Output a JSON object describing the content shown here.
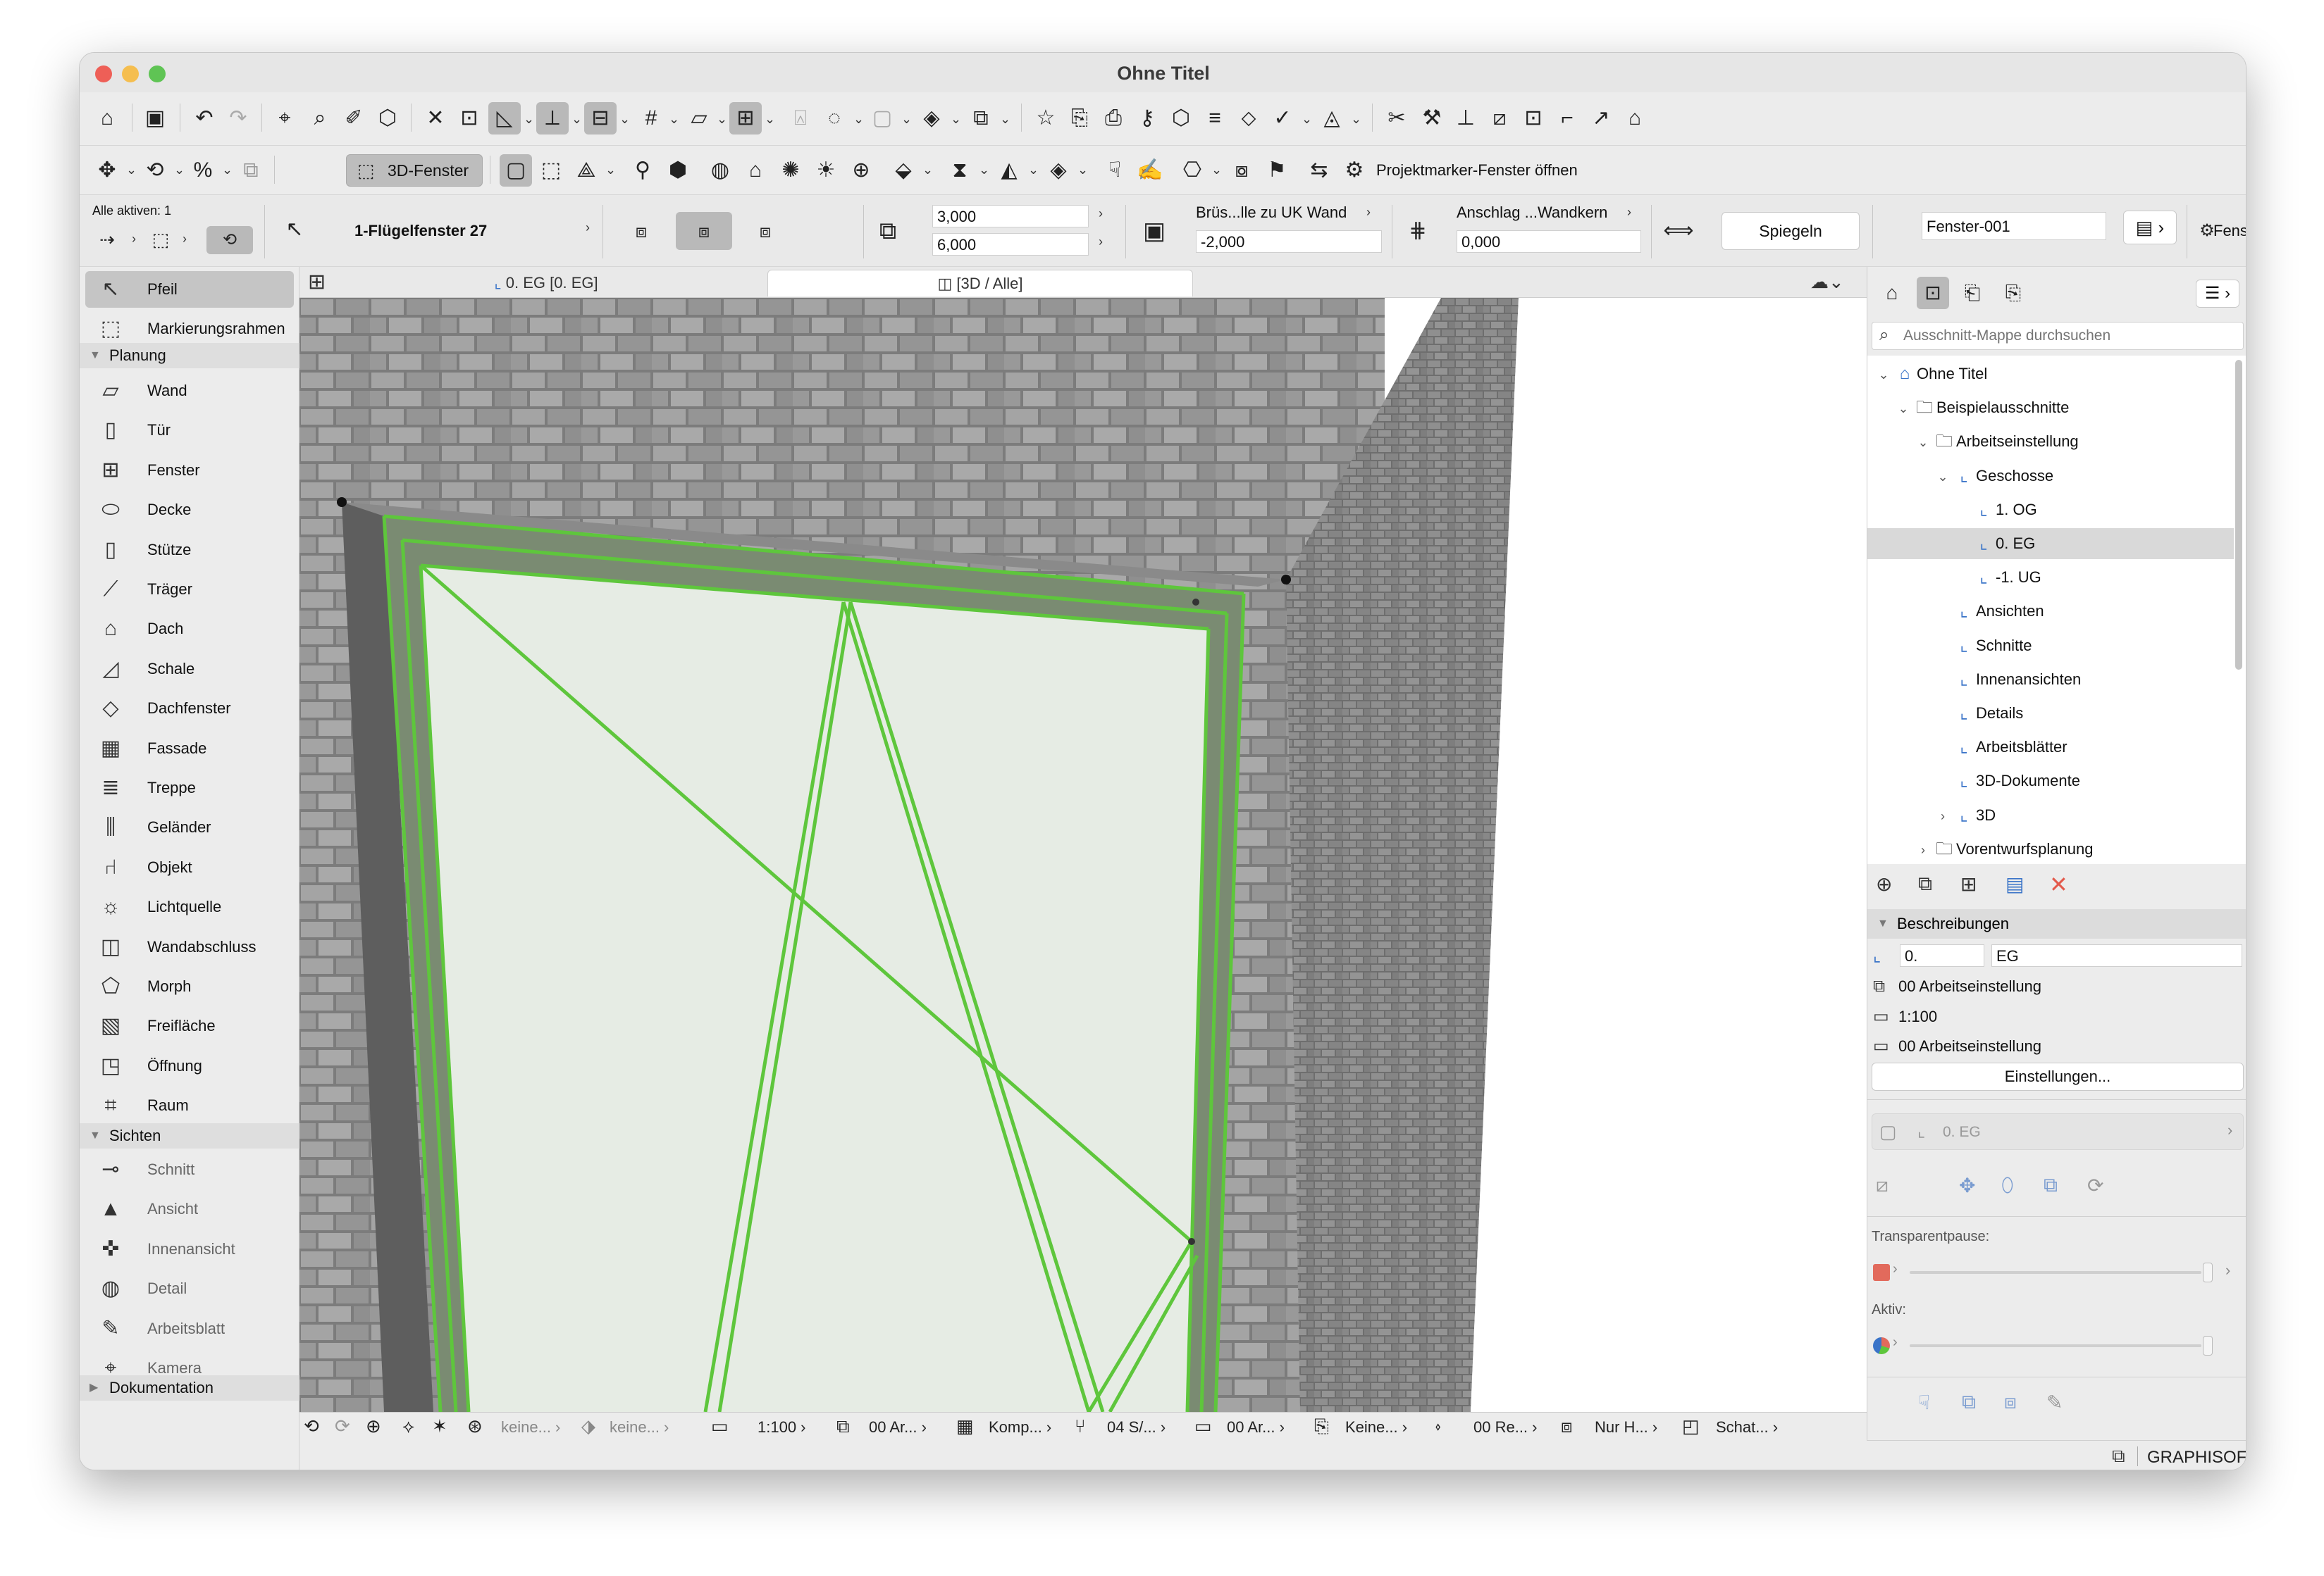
{
  "window": {
    "title": "Ohne Titel"
  },
  "toolbar2": {
    "view_3d_button": "3D-Fenster",
    "marker_button": "Projektmarker-Fenster öffnen"
  },
  "infobox": {
    "all_active": "Alle aktiven: 1",
    "element_name": "1-Flügelfenster 27",
    "width": "3,000",
    "height": "6,000",
    "sill_label": "Brüs...lle zu UK Wand",
    "sill_value": "-2,000",
    "anchor_label": "Anschlag ...Wandkern",
    "anchor_value": "0,000",
    "mirror_button": "Spiegeln",
    "element_id": "Fenster-001",
    "window_label": "Fens"
  },
  "toolbox": {
    "top_tools": [
      {
        "label": "Pfeil",
        "icon": "arrow-pointer-icon",
        "glyph": "↖"
      },
      {
        "label": "Markierungsrahmen",
        "icon": "marquee-icon",
        "glyph": "⬚"
      }
    ],
    "group_planung": "Planung",
    "planung_tools": [
      {
        "label": "Wand",
        "icon": "wall-icon",
        "glyph": "▱"
      },
      {
        "label": "Tür",
        "icon": "door-icon",
        "glyph": "▯"
      },
      {
        "label": "Fenster",
        "icon": "window-icon",
        "glyph": "⊞"
      },
      {
        "label": "Decke",
        "icon": "slab-icon",
        "glyph": "⬭"
      },
      {
        "label": "Stütze",
        "icon": "column-icon",
        "glyph": "▯"
      },
      {
        "label": "Träger",
        "icon": "beam-icon",
        "glyph": "⟋"
      },
      {
        "label": "Dach",
        "icon": "roof-icon",
        "glyph": "⌂"
      },
      {
        "label": "Schale",
        "icon": "shell-icon",
        "glyph": "◿"
      },
      {
        "label": "Dachfenster",
        "icon": "skylight-icon",
        "glyph": "◇"
      },
      {
        "label": "Fassade",
        "icon": "curtain-wall-icon",
        "glyph": "▦"
      },
      {
        "label": "Treppe",
        "icon": "stair-icon",
        "glyph": "≣"
      },
      {
        "label": "Geländer",
        "icon": "railing-icon",
        "glyph": "⫼"
      },
      {
        "label": "Objekt",
        "icon": "object-icon",
        "glyph": "⑁"
      },
      {
        "label": "Lichtquelle",
        "icon": "lamp-icon",
        "glyph": "☼"
      },
      {
        "label": "Wandabschluss",
        "icon": "wall-end-icon",
        "glyph": "◫"
      },
      {
        "label": "Morph",
        "icon": "morph-icon",
        "glyph": "⬠"
      },
      {
        "label": "Freifläche",
        "icon": "mesh-icon",
        "glyph": "▧"
      },
      {
        "label": "Öffnung",
        "icon": "opening-icon",
        "glyph": "◳"
      },
      {
        "label": "Raum",
        "icon": "zone-icon",
        "glyph": "⌗"
      }
    ],
    "group_sichten": "Sichten",
    "sichten_tools": [
      {
        "label": "Schnitt",
        "icon": "section-icon",
        "glyph": "⊸"
      },
      {
        "label": "Ansicht",
        "icon": "elevation-icon",
        "glyph": "▲"
      },
      {
        "label": "Innenansicht",
        "icon": "interior-elevation-icon",
        "glyph": "✜"
      },
      {
        "label": "Detail",
        "icon": "detail-icon",
        "glyph": "◍"
      },
      {
        "label": "Arbeitsblatt",
        "icon": "worksheet-icon",
        "glyph": "✎"
      },
      {
        "label": "Kamera",
        "icon": "camera-icon",
        "glyph": "⌖"
      }
    ],
    "group_dokumentation": "Dokumentation"
  },
  "tabs": {
    "floor_plan": "0. EG [0. EG]",
    "view_3d": "[3D / Alle]"
  },
  "statusbar": {
    "undo": "keine...",
    "filter": "keine...",
    "scale": "1:100",
    "layer": "00 Ar...",
    "composite": "Komp...",
    "pen": "04 S/...",
    "model_view": "00 Ar...",
    "override": "Keine...",
    "renovation": "00 Re...",
    "structure": "Nur H...",
    "shadow": "Schat..."
  },
  "navigator": {
    "search_placeholder": "Ausschnitt-Mappe durchsuchen",
    "tree": [
      {
        "label": "Ohne Titel",
        "level": 0,
        "toggle": "open",
        "kind": "project"
      },
      {
        "label": "Beispielausschnitte",
        "level": 1,
        "toggle": "open",
        "kind": "folder"
      },
      {
        "label": "Arbeitseinstellung",
        "level": 2,
        "toggle": "open",
        "kind": "folder"
      },
      {
        "label": "Geschosse",
        "level": 3,
        "toggle": "open",
        "kind": "view"
      },
      {
        "label": "1. OG",
        "level": 4,
        "toggle": "none",
        "kind": "view"
      },
      {
        "label": "0. EG",
        "level": 4,
        "toggle": "none",
        "kind": "view",
        "selected": true
      },
      {
        "label": "-1. UG",
        "level": 4,
        "toggle": "none",
        "kind": "view"
      },
      {
        "label": "Ansichten",
        "level": 3,
        "toggle": "none",
        "kind": "view"
      },
      {
        "label": "Schnitte",
        "level": 3,
        "toggle": "none",
        "kind": "view"
      },
      {
        "label": "Innenansichten",
        "level": 3,
        "toggle": "none",
        "kind": "view"
      },
      {
        "label": "Details",
        "level": 3,
        "toggle": "none",
        "kind": "view"
      },
      {
        "label": "Arbeitsblätter",
        "level": 3,
        "toggle": "none",
        "kind": "view"
      },
      {
        "label": "3D-Dokumente",
        "level": 3,
        "toggle": "none",
        "kind": "view"
      },
      {
        "label": "3D",
        "level": 3,
        "toggle": "closed",
        "kind": "view"
      },
      {
        "label": "Vorentwurfsplanung",
        "level": 2,
        "toggle": "closed",
        "kind": "folder"
      }
    ],
    "desc_header": "Beschreibungen",
    "desc_ref": "0.",
    "desc_name": "EG",
    "desc_layer": "00 Arbeitseinstellung",
    "desc_scale": "1:100",
    "desc_modelview": "00 Arbeitseinstellung",
    "settings_button": "Einstellungen...",
    "view_ref": "0. EG",
    "overlay_label": "Transparentpause:",
    "active_label": "Aktiv:",
    "footer_brand": "GRAPHISOFT ID"
  },
  "colors": {
    "selection": "#5ec63c",
    "accent": "#3a74c8",
    "brick": "#8e8e8e"
  }
}
